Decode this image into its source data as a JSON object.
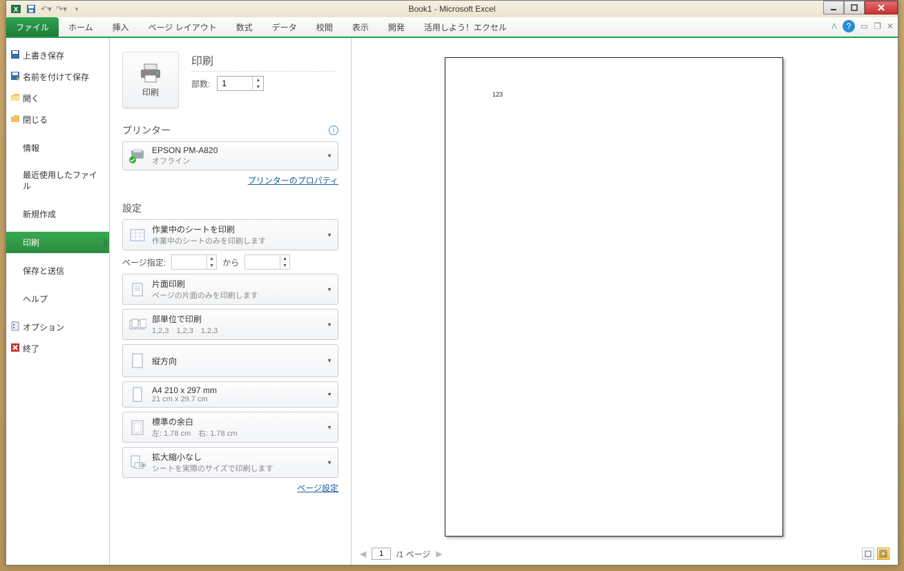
{
  "window": {
    "title": "Book1 - Microsoft Excel"
  },
  "ribbon": {
    "file": "ファイル",
    "tabs": [
      "ホーム",
      "挿入",
      "ページ レイアウト",
      "数式",
      "データ",
      "校閲",
      "表示",
      "開発",
      "活用しよう！エクセル"
    ]
  },
  "sidebar": {
    "items": [
      {
        "label": "上書き保存"
      },
      {
        "label": "名前を付けて保存"
      },
      {
        "label": "開く"
      },
      {
        "label": "閉じる"
      },
      {
        "label": "情報"
      },
      {
        "label": "最近使用したファイル"
      },
      {
        "label": "新規作成"
      },
      {
        "label": "印刷"
      },
      {
        "label": "保存と送信"
      },
      {
        "label": "ヘルプ"
      },
      {
        "label": "オプション"
      },
      {
        "label": "終了"
      }
    ]
  },
  "print": {
    "heading": "印刷",
    "button_label": "印刷",
    "copies_label": "部数:",
    "copies_value": "1",
    "printer_heading": "プリンター",
    "printer_name": "EPSON PM-A820",
    "printer_status": "オフライン",
    "printer_properties": "プリンターのプロパティ",
    "settings_heading": "設定",
    "scope": {
      "title": "作業中のシートを印刷",
      "sub": "作業中のシートのみを印刷します"
    },
    "page_range_label": "ページ指定:",
    "page_range_to": "から",
    "page_from": "",
    "page_to": "",
    "duplex": {
      "title": "片面印刷",
      "sub": "ページの片面のみを印刷します"
    },
    "collate": {
      "title": "部単位で印刷",
      "sub": "1,2,3　1,2,3　1,2,3"
    },
    "orientation": {
      "title": "縦方向"
    },
    "paper": {
      "title": "A4 210 x 297 mm",
      "sub": "21 cm x 29.7 cm"
    },
    "margins": {
      "title": "標準の余白",
      "sub": "左:  1.78 cm　右:  1.78 cm"
    },
    "scaling": {
      "title": "拡大縮小なし",
      "sub": "シートを実際のサイズで印刷します"
    },
    "page_setup_link": "ページ設定"
  },
  "preview": {
    "content": "123",
    "current_page": "1",
    "page_total_label": "/1 ページ"
  }
}
